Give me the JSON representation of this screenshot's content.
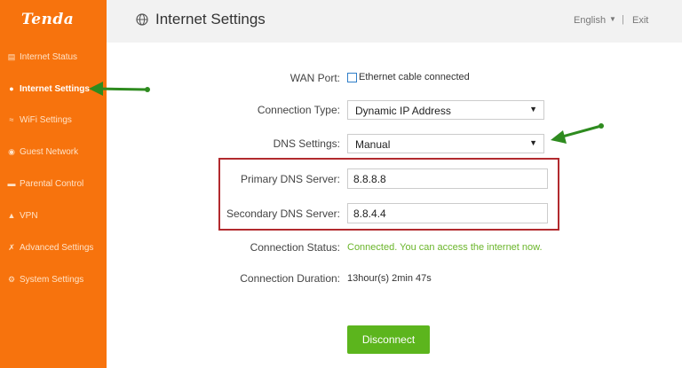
{
  "brand": "Tenda",
  "header": {
    "title": "Internet Settings",
    "language": "English",
    "separator": "|",
    "exit": "Exit"
  },
  "sidebar": {
    "items": [
      {
        "label": "Internet Status",
        "icon": "monitor-icon"
      },
      {
        "label": "Internet Settings",
        "icon": "globe-icon",
        "active": true
      },
      {
        "label": "WiFi Settings",
        "icon": "wifi-icon"
      },
      {
        "label": "Guest Network",
        "icon": "guest-icon"
      },
      {
        "label": "Parental Control",
        "icon": "parental-icon"
      },
      {
        "label": "VPN",
        "icon": "vpn-icon"
      },
      {
        "label": "Advanced Settings",
        "icon": "wrench-icon"
      },
      {
        "label": "System Settings",
        "icon": "gear-icon"
      }
    ]
  },
  "form": {
    "wan_port_label": "WAN Port:",
    "wan_port_value": "Ethernet cable connected",
    "connection_type_label": "Connection Type:",
    "connection_type_value": "Dynamic IP Address",
    "dns_settings_label": "DNS Settings:",
    "dns_settings_value": "Manual",
    "primary_dns_label": "Primary DNS Server:",
    "primary_dns_value": "8.8.8.8",
    "secondary_dns_label": "Secondary DNS Server:",
    "secondary_dns_value": "8.8.4.4",
    "connection_status_label": "Connection Status:",
    "connection_status_value": "Connected. You can access the internet now.",
    "connection_duration_label": "Connection Duration:",
    "connection_duration_value": "13hour(s) 2min 47s",
    "disconnect_label": "Disconnect"
  },
  "colors": {
    "sidebar": "#f7730d",
    "accent_green": "#5cb51d",
    "status_green": "#6ab52a",
    "annotation_arrow": "#2e8b1f",
    "highlight_box": "#b22a2e"
  }
}
